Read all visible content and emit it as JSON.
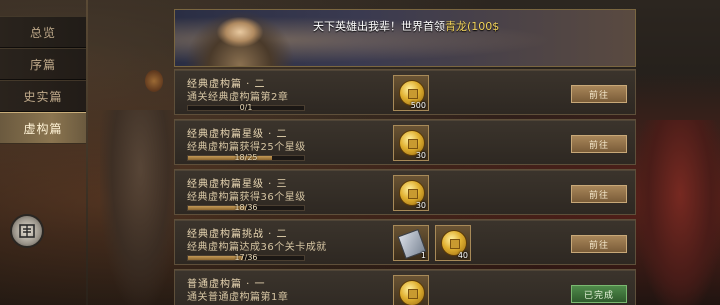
{
  "sidebar": {
    "items": [
      {
        "label": "总览",
        "active": false
      },
      {
        "label": "序篇",
        "active": false
      },
      {
        "label": "史实篇",
        "active": false
      },
      {
        "label": "虚构篇",
        "active": true
      }
    ]
  },
  "banner": {
    "text_main": "天下英雄出我辈！世界首领",
    "text_highlight": "青龙(100$"
  },
  "tasks": [
    {
      "title": "经典虚构篇 · 二",
      "description": "通关经典虚构篇第2章",
      "progress_text": "0/1",
      "progress": 0.0,
      "rewards": [
        {
          "icon": "gold-coin-icon",
          "qty": "500"
        }
      ],
      "button": "前往",
      "done": false
    },
    {
      "title": "经典虚构篇星级 · 二",
      "description": "经典虚构篇获得25个星级",
      "progress_text": "18/25",
      "progress": 0.72,
      "rewards": [
        {
          "icon": "gold-coin-icon",
          "qty": "30"
        }
      ],
      "button": "前往",
      "done": false
    },
    {
      "title": "经典虚构篇星级 · 三",
      "description": "经典虚构篇获得36个星级",
      "progress_text": "18/36",
      "progress": 0.5,
      "rewards": [
        {
          "icon": "gold-coin-icon",
          "qty": "30"
        }
      ],
      "button": "前往",
      "done": false
    },
    {
      "title": "经典虚构篇挑战 · 二",
      "description": "经典虚构篇达成36个关卡成就",
      "progress_text": "17/36",
      "progress": 0.47,
      "rewards": [
        {
          "icon": "ticket-icon",
          "qty": "1"
        },
        {
          "icon": "gold-coin-icon",
          "qty": "40"
        }
      ],
      "button": "前往",
      "done": false
    },
    {
      "title": "普通虚构篇 · 一",
      "description": "通关普通虚构篇第1章",
      "progress_text": "",
      "progress": 1.0,
      "rewards": [
        {
          "icon": "gold-coin-icon",
          "qty": ""
        }
      ],
      "button": "已完成",
      "done": true
    }
  ]
}
